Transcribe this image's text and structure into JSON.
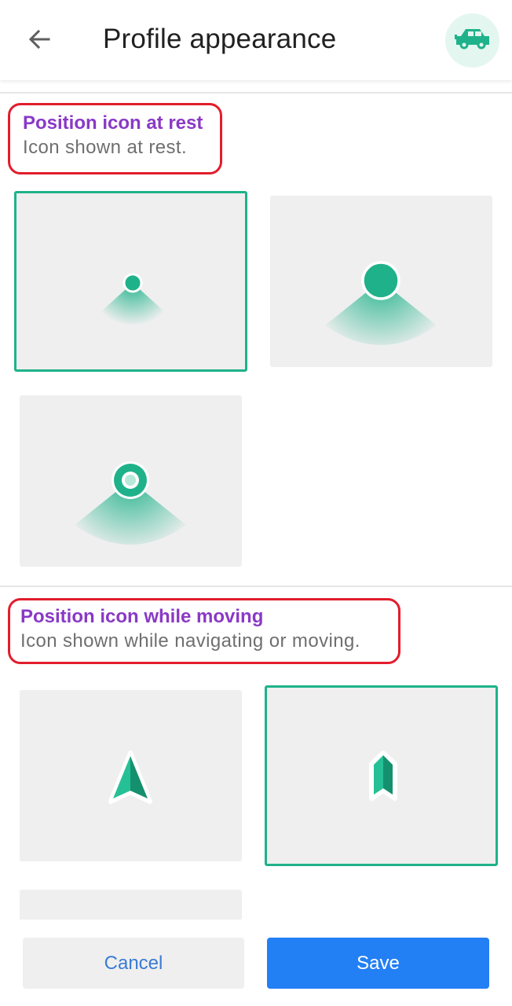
{
  "header": {
    "title": "Profile appearance",
    "back_icon": "arrow-left-icon",
    "profile_icon": "car-icon",
    "accent_color": "#1fb28a"
  },
  "rest_section": {
    "title": "Position icon at rest",
    "subtitle": "Icon shown at rest.",
    "options": [
      {
        "id": "small-dot",
        "selected": true
      },
      {
        "id": "large-dot",
        "selected": false
      },
      {
        "id": "ring-dot",
        "selected": false
      }
    ]
  },
  "moving_section": {
    "title": "Position icon while moving",
    "subtitle": "Icon shown while navigating or moving.",
    "options": [
      {
        "id": "arrow",
        "selected": false
      },
      {
        "id": "chevron-bookmark",
        "selected": true
      },
      {
        "id": "third-option",
        "selected": false
      }
    ]
  },
  "footer": {
    "cancel_label": "Cancel",
    "save_label": "Save"
  },
  "colors": {
    "title_purple": "#8a39c6",
    "highlight_red": "#e21d2c",
    "save_blue": "#237ff4",
    "cancel_text": "#3a7bd5",
    "icon_green": "#1fb28a"
  }
}
